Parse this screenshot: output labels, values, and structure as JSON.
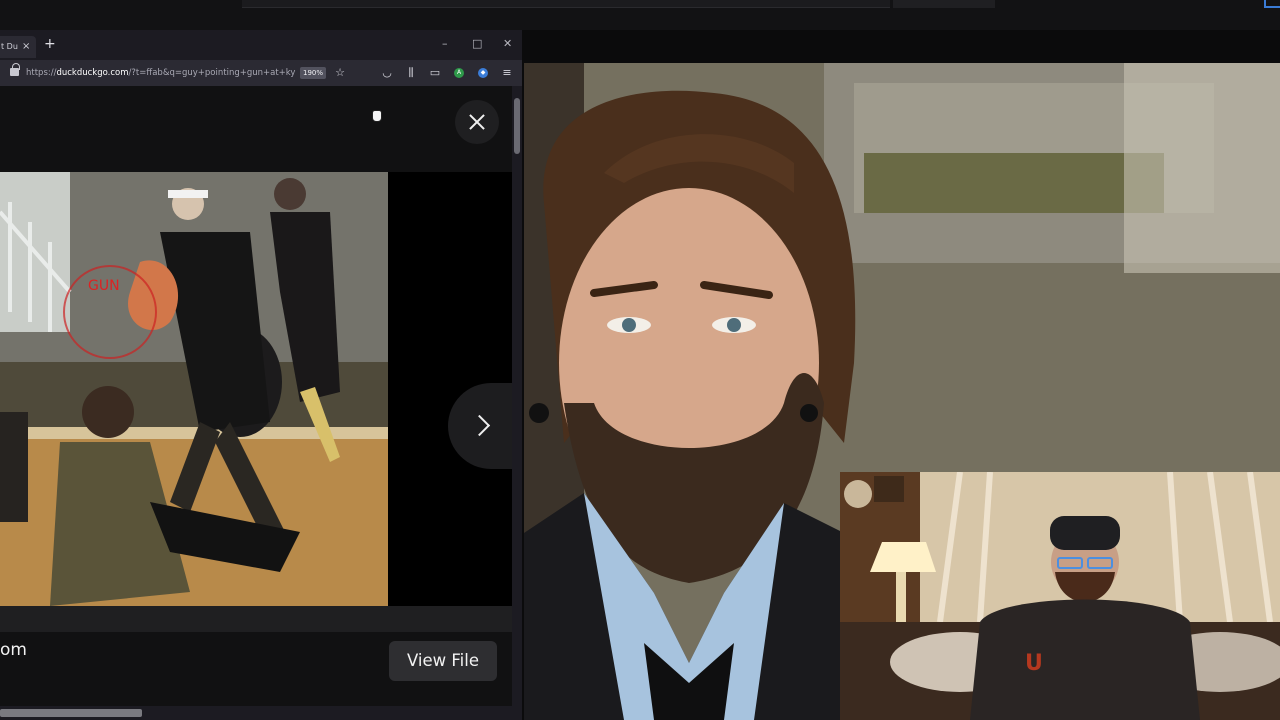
{
  "browser": {
    "tab_title": "t Du",
    "tab_close": "×",
    "new_tab": "+",
    "window_controls": {
      "minimize": "–",
      "maximize": "□",
      "close": "✕"
    },
    "url_prefix": "https://",
    "url_domain": "duckduckgo.com",
    "url_rest": "/?t=ffab&q=guy+pointing+gun+at+kyle",
    "zoom": "190%",
    "toolbar_icons": [
      "star-icon",
      "pocket-icon",
      "library-icon",
      "reader-view-icon",
      "extension-icon",
      "extension-icon",
      "menu-icon"
    ]
  },
  "viewer": {
    "source_text": "om",
    "view_file_label": "View File",
    "photo_label": "GUN"
  },
  "colors": {
    "browser_bg": "#1c1b22",
    "navbar_bg": "#2b2a33",
    "viewer_bg": "#111112",
    "accent_blue": "#3a7bd5"
  }
}
